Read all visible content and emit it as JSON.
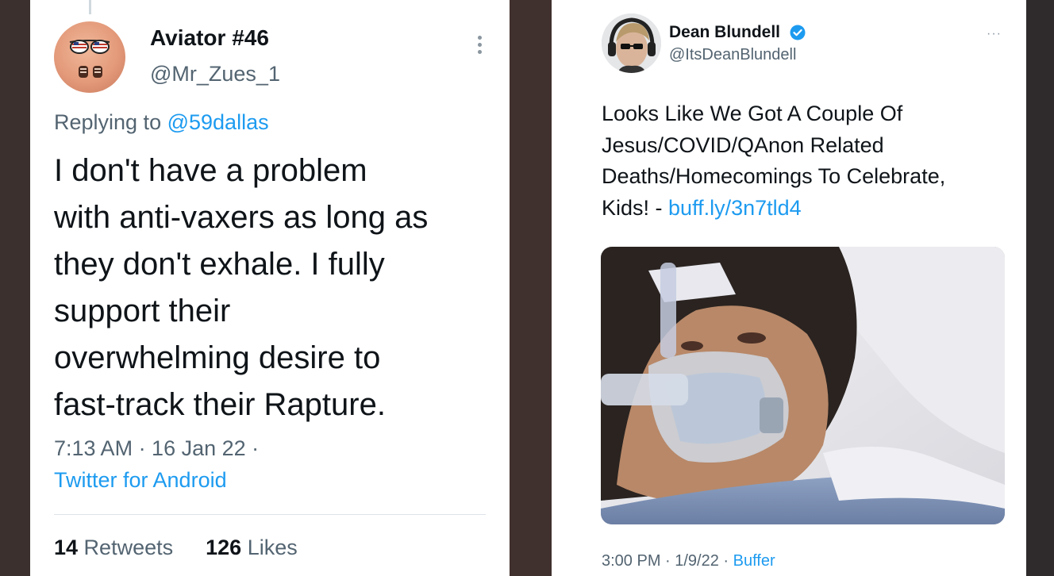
{
  "left_tweet": {
    "author_name": "Aviator #46",
    "author_handle": "@Mr_Zues_1",
    "avatar_icon": "aviator-avatar",
    "replying_prefix": "Replying to ",
    "replying_mention": "@59dallas",
    "text_lines": [
      "I don't have a problem",
      "with anti-vaxers as long as",
      "they don't exhale. I fully",
      "support their",
      "overwhelming desire to",
      "fast-track their Rapture."
    ],
    "timestamp": "7:13 AM · 16 Jan 22 ·",
    "client": "Twitter for Android",
    "retweets_count": "14",
    "retweets_label": " Retweets",
    "likes_count": "126",
    "likes_label": " Likes"
  },
  "right_tweet": {
    "author_name": "Dean Blundell",
    "author_handle": "@ItsDeanBlundell",
    "verified_icon": "verified-badge-icon",
    "more_icon": "···",
    "text_lines": [
      "Looks Like We Got A Couple Of",
      "Jesus/COVID/QAnon Related",
      "Deaths/Homecomings To Celebrate,"
    ],
    "last_line_prefix": "Kids! - ",
    "link": "buff.ly/3n7tld4",
    "image_alt": "hospital-patient-photo",
    "timestamp": "3:00 PM · 1/9/22 · ",
    "source": "Buffer"
  },
  "colors": {
    "link_blue": "#1d9bf0",
    "text_primary": "#0f1419",
    "text_secondary": "#536471"
  }
}
